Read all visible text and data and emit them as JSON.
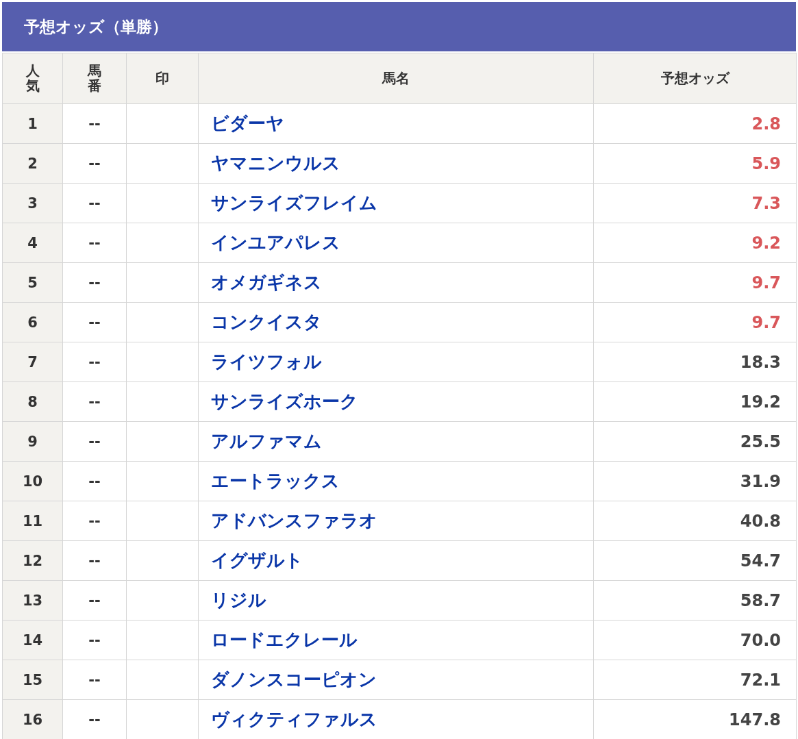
{
  "title": "予想オッズ（単勝）",
  "columns": [
    "人気",
    "馬番",
    "印",
    "馬名",
    "予想オッズ"
  ],
  "rows": [
    {
      "rank": "1",
      "number": "--",
      "name": "ビダーヤ",
      "odds": "2.8",
      "highlighted": true
    },
    {
      "rank": "2",
      "number": "--",
      "name": "ヤマニンウルス",
      "odds": "5.9",
      "highlighted": true
    },
    {
      "rank": "3",
      "number": "--",
      "name": "サンライズフレイム",
      "odds": "7.3",
      "highlighted": true
    },
    {
      "rank": "4",
      "number": "--",
      "name": "インユアパレス",
      "odds": "9.2",
      "highlighted": true
    },
    {
      "rank": "5",
      "number": "--",
      "name": "オメガギネス",
      "odds": "9.7",
      "highlighted": true
    },
    {
      "rank": "6",
      "number": "--",
      "name": "コンクイスタ",
      "odds": "9.7",
      "highlighted": true
    },
    {
      "rank": "7",
      "number": "--",
      "name": "ライツフォル",
      "odds": "18.3",
      "highlighted": false
    },
    {
      "rank": "8",
      "number": "--",
      "name": "サンライズホーク",
      "odds": "19.2",
      "highlighted": false
    },
    {
      "rank": "9",
      "number": "--",
      "name": "アルファマム",
      "odds": "25.5",
      "highlighted": false
    },
    {
      "rank": "10",
      "number": "--",
      "name": "エートラックス",
      "odds": "31.9",
      "highlighted": false
    },
    {
      "rank": "11",
      "number": "--",
      "name": "アドバンスファラオ",
      "odds": "40.8",
      "highlighted": false
    },
    {
      "rank": "12",
      "number": "--",
      "name": "イグザルト",
      "odds": "54.7",
      "highlighted": false
    },
    {
      "rank": "13",
      "number": "--",
      "name": "リジル",
      "odds": "58.7",
      "highlighted": false
    },
    {
      "rank": "14",
      "number": "--",
      "name": "ロードエクレール",
      "odds": "70.0",
      "highlighted": false
    },
    {
      "rank": "15",
      "number": "--",
      "name": "ダノンスコーピオン",
      "odds": "72.1",
      "highlighted": false
    },
    {
      "rank": "16",
      "number": "--",
      "name": "ヴィクティファルス",
      "odds": "147.8",
      "highlighted": false
    }
  ]
}
